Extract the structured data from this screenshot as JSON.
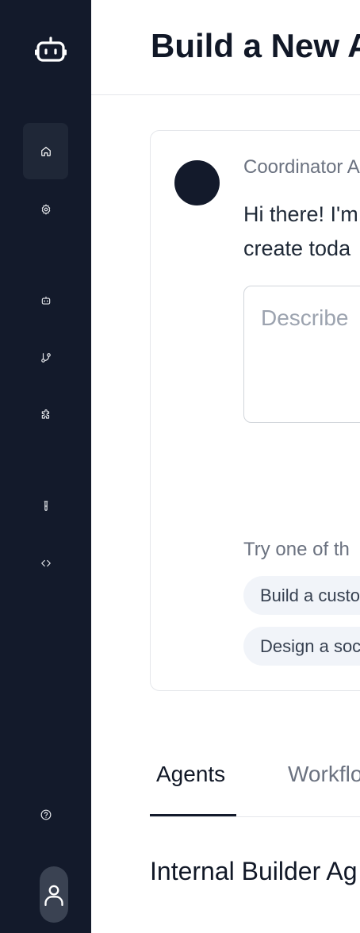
{
  "sidebar": {
    "items": [
      {
        "icon": "home-icon",
        "active": true
      },
      {
        "icon": "gear-icon",
        "active": false
      },
      {
        "icon": "robot-icon",
        "active": false
      },
      {
        "icon": "git-branch-icon",
        "active": false
      },
      {
        "icon": "puzzle-icon",
        "active": false
      },
      {
        "icon": "test-tube-icon",
        "active": false
      },
      {
        "icon": "code-icon",
        "active": false
      },
      {
        "icon": "help-circle-icon",
        "active": false
      }
    ],
    "logo_icon": "robot-icon",
    "user_icon": "user-icon"
  },
  "header": {
    "title": "Build a New A"
  },
  "coordinator": {
    "name": "Coordinator A",
    "greeting_line1": "Hi there! I'm",
    "greeting_line2": "create toda",
    "prompt_placeholder": "Describe "
  },
  "suggestions": {
    "label": "Try one of th",
    "chips": [
      "Build a custo",
      "Design a soc"
    ]
  },
  "tabs": [
    {
      "label": "Agents",
      "active": true
    },
    {
      "label": "Workflo",
      "active": false
    }
  ],
  "section": {
    "title": "Internal Builder Ag"
  },
  "colors": {
    "sidebar_bg": "#131a2b",
    "active_item_bg": "#1f2737",
    "chip_bg": "#f1f4f9"
  }
}
